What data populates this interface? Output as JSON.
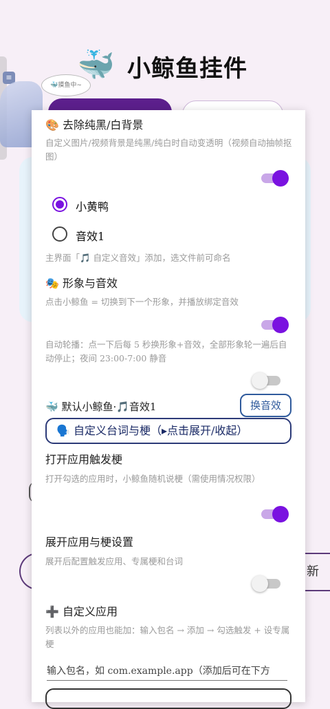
{
  "background": {
    "app_title": "小鲸鱼挂件",
    "whale_icon": "whale-icon",
    "bubble_text": "🐳摸鱼中~",
    "right_fragment": "新"
  },
  "panel": {
    "bg_removal": {
      "icon": "🎨",
      "title": "去除纯黑/白背景",
      "desc": "自定义图片/视频背景是纯黑/纯白时自动变透明（视频自动抽帧抠图）",
      "enabled": true
    },
    "sound_options": [
      {
        "label": "小黄鸭",
        "selected": true
      },
      {
        "label": "音效1",
        "selected": false
      }
    ],
    "sound_hint": "主界面「🎵 自定义音效」添加，选文件前可命名",
    "image_sound": {
      "icon": "🎭",
      "title": "形象与音效",
      "desc": "点击小鲸鱼 = 切换到下一个形象，并播放绑定音效",
      "enabled": true
    },
    "auto_rotate": {
      "desc": "自动轮播：点一下后每 5 秒换形象+音效，全部形象轮一遍后自动停止；夜间 23:00-7:00 静音",
      "enabled": false
    },
    "default_whale": {
      "label": "🐳 默认小鲸鱼·🎵音效1",
      "button": "换音效"
    },
    "custom_lines_button": "🗣️ 自定义台词与梗（▸点击展开/收起）",
    "open_app_trigger": {
      "title": "打开应用触发梗",
      "desc": "打开勾选的应用时，小鲸鱼随机说梗（需使用情况权限）",
      "enabled": true
    },
    "expand_app_settings": {
      "title": "展开应用与梗设置",
      "desc": "展开后配置触发应用、专属梗和台词",
      "enabled": false
    },
    "custom_app": {
      "icon": "➕",
      "title": "自定义应用",
      "desc": "列表以外的应用也能加：输入包名 → 添加 → 勾选触发 + 设专属梗",
      "input_placeholder": "输入包名，如 com.example.app（添加后可在下方"
    }
  },
  "colors": {
    "accent": "#7a12e0",
    "button_blue": "#2f5a9c"
  }
}
